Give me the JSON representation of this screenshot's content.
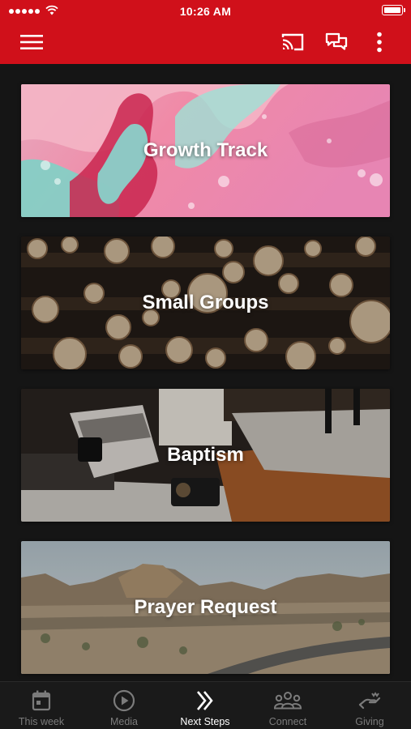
{
  "status_bar": {
    "time": "10:26 AM"
  },
  "app_bar": {
    "menu_icon": "hamburger-menu-icon",
    "cast_icon": "cast-icon",
    "chat_icon": "chat-icon",
    "more_icon": "more-vertical-icon",
    "color": "#d0101a"
  },
  "cards": [
    {
      "title": "Growth Track",
      "image": "pink-teal-marbled-paint"
    },
    {
      "title": "Small Groups",
      "image": "stacked-log-ends"
    },
    {
      "title": "Baptism",
      "image": "cameras-on-table-interior"
    },
    {
      "title": "Prayer Request",
      "image": "desert-road-landscape"
    }
  ],
  "tabs": [
    {
      "label": "This week",
      "icon": "calendar-icon",
      "active": false
    },
    {
      "label": "Media",
      "icon": "play-circle-icon",
      "active": false
    },
    {
      "label": "Next Steps",
      "icon": "double-chevron-right-icon",
      "active": true
    },
    {
      "label": "Connect",
      "icon": "group-people-icon",
      "active": false
    },
    {
      "label": "Giving",
      "icon": "giving-hand-icon",
      "active": false
    }
  ]
}
